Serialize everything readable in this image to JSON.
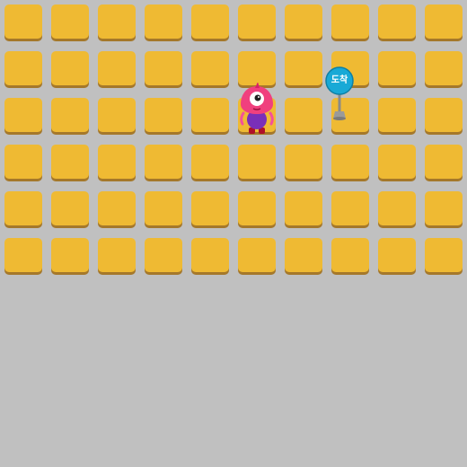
{
  "board": {
    "rows": 6,
    "cols": 10,
    "tile_color": "#efba33",
    "tile_shadow_color": "#a5782a",
    "background_color": "#c0c0c0"
  },
  "character": {
    "icon": "pink-one-eyed-monster-icon",
    "row": 2,
    "col": 5
  },
  "goal": {
    "icon": "arrival-sign-icon",
    "label": "도착",
    "row": 2,
    "col": 7,
    "sign_color": "#18a9d6"
  }
}
